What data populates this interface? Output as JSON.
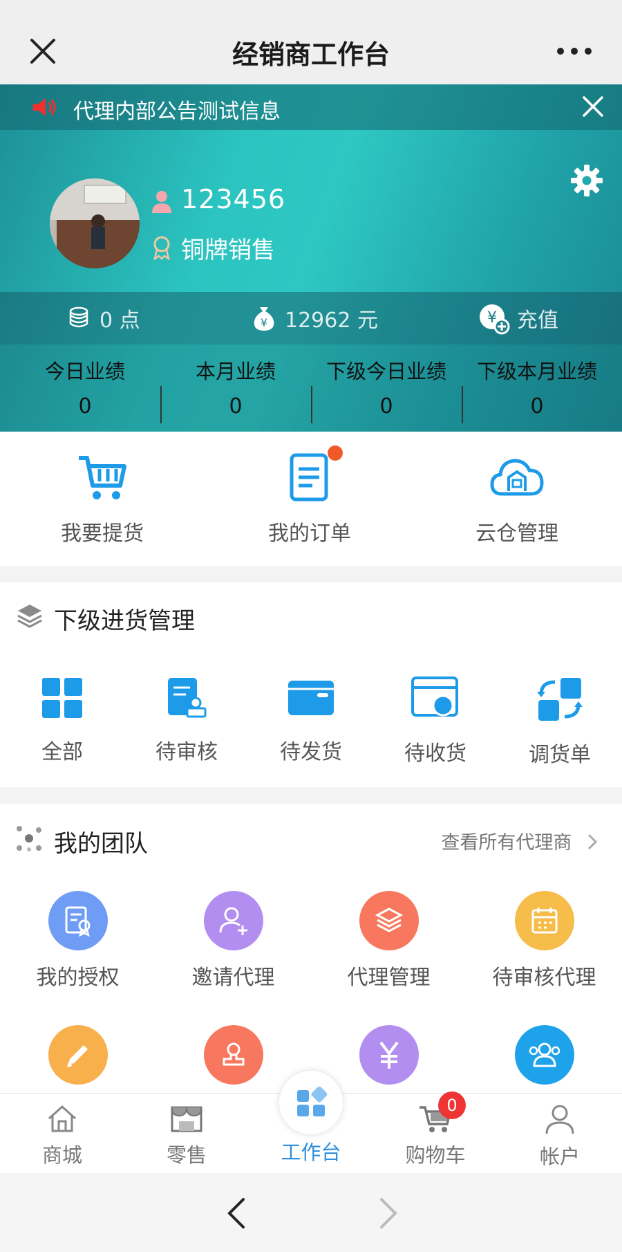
{
  "titlebar": {
    "title": "经销商工作台"
  },
  "notice": {
    "text": "代理内部公告测试信息"
  },
  "profile": {
    "username": "123456",
    "rank": "铜牌销售"
  },
  "wallet": {
    "points": "0 点",
    "balance": "12962 元",
    "recharge": "充值"
  },
  "stats": [
    {
      "label": "今日业绩",
      "value": "0"
    },
    {
      "label": "本月业绩",
      "value": "0"
    },
    {
      "label": "下级今日业绩",
      "value": "0"
    },
    {
      "label": "下级本月业绩",
      "value": "0"
    }
  ],
  "quick_actions": [
    {
      "label": "我要提货",
      "icon": "cart-icon"
    },
    {
      "label": "我的订单",
      "icon": "order-icon"
    },
    {
      "label": "云仓管理",
      "icon": "cloud-warehouse-icon"
    }
  ],
  "purchase_section": {
    "title": "下级进货管理",
    "items": [
      {
        "label": "全部",
        "icon": "grid-icon"
      },
      {
        "label": "待审核",
        "icon": "review-icon"
      },
      {
        "label": "待发货",
        "icon": "box-icon"
      },
      {
        "label": "待收货",
        "icon": "receive-icon"
      },
      {
        "label": "调货单",
        "icon": "transfer-icon"
      }
    ]
  },
  "team_section": {
    "title": "我的团队",
    "view_all": "查看所有代理商",
    "items": [
      {
        "label": "我的授权",
        "icon": "certificate-icon",
        "color": "#6f9cf5"
      },
      {
        "label": "邀请代理",
        "icon": "add-user-icon",
        "color": "#b28ef0"
      },
      {
        "label": "代理管理",
        "icon": "layers-icon",
        "color": "#f7785f"
      },
      {
        "label": "待审核代理",
        "icon": "calendar-icon",
        "color": "#f6bd4b"
      }
    ],
    "row2_icons": [
      {
        "icon": "pencil-icon",
        "color": "#f7b04b"
      },
      {
        "icon": "stamp-icon",
        "color": "#f7785f"
      },
      {
        "icon": "yen-icon",
        "color": "#b28ef0"
      },
      {
        "icon": "group-icon",
        "color": "#1ea3ea"
      }
    ]
  },
  "tabbar": {
    "items": [
      {
        "label": "商城",
        "icon": "home-icon"
      },
      {
        "label": "零售",
        "icon": "store-icon"
      },
      {
        "label": "工作台",
        "icon": "workbench-icon"
      },
      {
        "label": "购物车",
        "icon": "shopping-cart-icon"
      },
      {
        "label": "帐户",
        "icon": "account-icon"
      }
    ],
    "cart_badge": "0",
    "active_color": "#2d8fe0"
  }
}
